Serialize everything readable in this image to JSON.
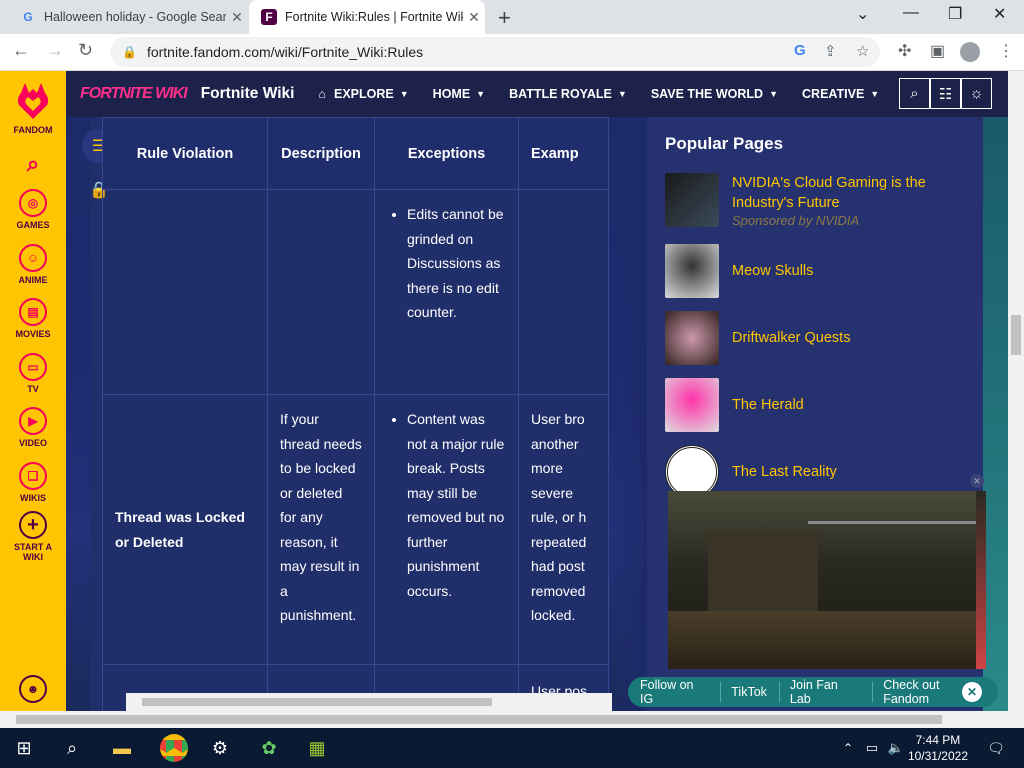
{
  "browser": {
    "tabs": [
      {
        "title": "Halloween holiday - Google Sear",
        "favicon": "G"
      },
      {
        "title": "Fortnite Wiki:Rules | Fortnite Wik",
        "favicon": "F"
      }
    ],
    "url": "fortnite.fandom.com/wiki/Fortnite_Wiki:Rules"
  },
  "fandom_sidebar": {
    "brand": "FANDOM",
    "items": [
      "GAMES",
      "ANIME",
      "MOVIES",
      "TV",
      "VIDEO",
      "WIKIS",
      "START A WIKI"
    ]
  },
  "wiki_nav": {
    "logo": "FORTNITE WIKI",
    "name": "Fortnite Wiki",
    "items": [
      "EXPLORE",
      "HOME",
      "BATTLE ROYALE",
      "SAVE THE WORLD",
      "CREATIVE"
    ]
  },
  "table": {
    "headers": [
      "Rule Violation",
      "Description",
      "Exceptions",
      "Examp"
    ],
    "row1": {
      "exception_item": "Edits cannot be grinded on Discussions as there is no edit counter."
    },
    "row2": {
      "violation": "Thread was Locked or Deleted",
      "description": "If your thread needs to be locked or deleted for any reason, it may result in a punishment.",
      "exception_item": "Content was not a major rule break. Posts may still be removed but no further punishment occurs.",
      "example": "User bro another more severe rule, or h repeated had post removed locked."
    },
    "row3": {
      "example": "User pos"
    }
  },
  "popular_pages": {
    "title": "Popular Pages",
    "items": [
      {
        "title": "NVIDIA's Cloud Gaming is the Industry's Future",
        "sponsor": "Sponsored by NVIDIA"
      },
      {
        "title": "Meow Skulls"
      },
      {
        "title": "Driftwalker Quests"
      },
      {
        "title": "The Herald"
      },
      {
        "title": "The Last Reality"
      }
    ]
  },
  "follow_bar": {
    "links": [
      "Follow on IG",
      "TikTok",
      "Join Fan Lab",
      "Check out Fandom"
    ]
  },
  "taskbar": {
    "time": "7:44 PM",
    "date": "10/31/2022"
  }
}
